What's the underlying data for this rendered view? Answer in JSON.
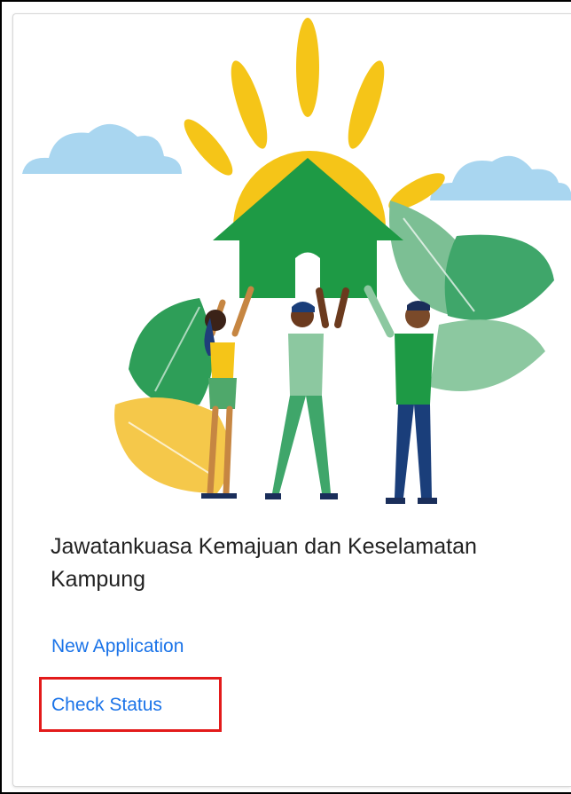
{
  "card": {
    "title": "Jawatankuasa Kemajuan dan Keselamatan Kampung",
    "links": [
      {
        "label": "New Application"
      },
      {
        "label": "Check Status",
        "highlighted": true
      }
    ]
  },
  "illustration": {
    "icons": [
      "cloud-icon",
      "sun-icon",
      "house-icon",
      "leaf-icon",
      "people-icon"
    ]
  },
  "colors": {
    "link": "#1a73e8",
    "title": "#222222",
    "highlight": "#e31b1b",
    "sun": "#f5c518",
    "house": "#1e9a45",
    "cloud": "#a9d6f0",
    "leaf_dark": "#2e9e58",
    "leaf_light": "#8cc8a0"
  }
}
